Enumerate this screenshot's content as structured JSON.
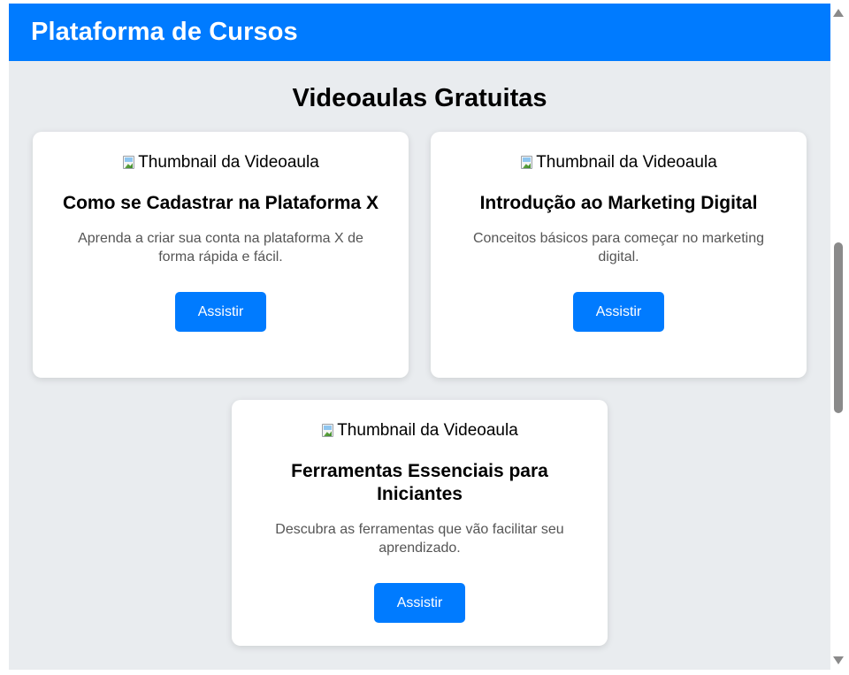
{
  "header": {
    "title": "Plataforma de Cursos"
  },
  "main": {
    "title": "Videoaulas Gratuitas"
  },
  "videos": [
    {
      "thumbnail_alt": "Thumbnail da Videoaula",
      "title": "Como se Cadastrar na Plataforma X",
      "description": "Aprenda a criar sua conta na plataforma X de forma rápida e fácil.",
      "button_label": "Assistir"
    },
    {
      "thumbnail_alt": "Thumbnail da Videoaula",
      "title": "Introdução ao Marketing Digital",
      "description": "Conceitos básicos para começar no marketing digital.",
      "button_label": "Assistir"
    },
    {
      "thumbnail_alt": "Thumbnail da Videoaula",
      "title": "Ferramentas Essenciais para Iniciantes",
      "description": "Descubra as ferramentas que vão facilitar seu aprendizado.",
      "button_label": "Assistir"
    }
  ],
  "colors": {
    "primary": "#007bff",
    "background": "#e9ecef",
    "card": "#ffffff"
  }
}
